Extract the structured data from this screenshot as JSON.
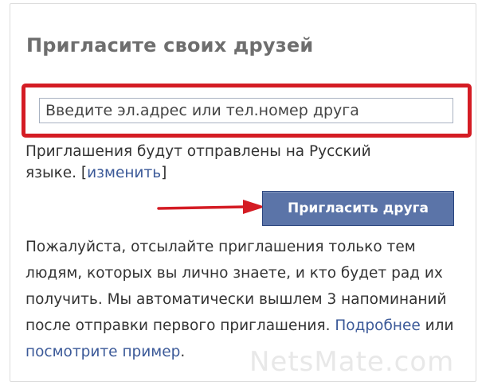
{
  "widget": {
    "title": "Пригласите своих друзей"
  },
  "invite_form": {
    "input_placeholder": "Введите эл.адрес или тел.номер друга",
    "language_note": "Приглашения будут отправлены на Русский языке.",
    "bracket_open": "[",
    "change_link": "изменить",
    "bracket_close": "]",
    "submit_label": "Пригласить друга"
  },
  "info": {
    "text": "Пожалуйста, отсылайте приглашения только тем людям, которых вы лично знаете, и кто будет рад их получить. Мы автоматически вышлем 3 напоминаний после отправки первого приглашения.",
    "learn_more_link": "Подробнее",
    "separator": "или",
    "example_link": "посмотрите пример",
    "trailing": "."
  },
  "watermark": {
    "text": "NetsMate.com"
  },
  "colors": {
    "highlight_frame": "#d41c24",
    "arrow": "#d41c24",
    "button_bg": "#5b74a8",
    "link": "#3b5998"
  },
  "icons": {
    "arrow": "arrow-right-icon"
  }
}
